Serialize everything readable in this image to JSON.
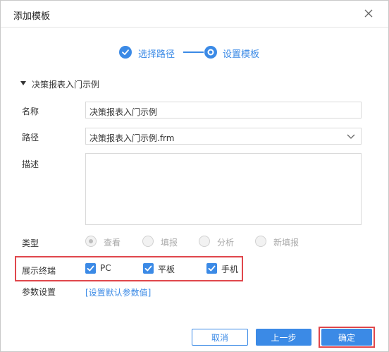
{
  "dialog": {
    "title": "添加模板",
    "close_icon": "close-icon"
  },
  "steps": [
    {
      "label": "选择路径",
      "state": "done",
      "icon": "check-circle-icon"
    },
    {
      "label": "设置模板",
      "state": "current",
      "icon": "radio-dot-icon"
    }
  ],
  "section": {
    "label": "决策报表入门示例",
    "expanded": true
  },
  "form": {
    "name_label": "名称",
    "name_value": "决策报表入门示例",
    "path_label": "路径",
    "path_value": "决策报表入门示例.frm",
    "desc_label": "描述",
    "desc_value": "",
    "type_label": "类型",
    "type_options": [
      {
        "label": "查看",
        "checked": true
      },
      {
        "label": "填报",
        "checked": false
      },
      {
        "label": "分析",
        "checked": false
      },
      {
        "label": "新填报",
        "checked": false
      }
    ],
    "terminal_label": "展示终端",
    "terminals": [
      {
        "label": "PC",
        "checked": true
      },
      {
        "label": "平板",
        "checked": true
      },
      {
        "label": "手机",
        "checked": true
      }
    ],
    "params_label": "参数设置",
    "params_link": "[设置默认参数值]"
  },
  "buttons": {
    "cancel": "取消",
    "prev": "上一步",
    "ok": "确定"
  },
  "colors": {
    "accent": "#3b8ae6",
    "highlight": "#e0474c",
    "disabled_text": "#a9a9a9"
  }
}
